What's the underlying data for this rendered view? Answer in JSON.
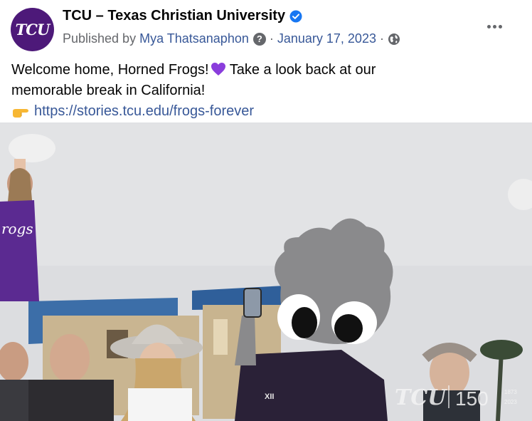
{
  "page": {
    "name": "TCU – Texas Christian University",
    "avatar_text": "TCU",
    "verified_icon": "verified-badge-icon",
    "accent_color": "#4d1979"
  },
  "meta": {
    "published_by_prefix": "Published by",
    "author": "Mya Thatsanaphon",
    "help_glyph": "?",
    "separator": "·",
    "date": "January 17, 2023",
    "audience_icon": "globe-icon"
  },
  "post": {
    "line1": "Welcome home, Horned Frogs!",
    "line1b": " Take a look back at our",
    "line2": "memorable break in California!",
    "link_emoji_icon": "pointing-right-icon",
    "link": "https://stories.tcu.edu/frogs-forever"
  },
  "media": {
    "cheer_text": "rogs",
    "mascot_chest_text": "XII",
    "watermark_logo": "TCU",
    "watermark_150": "150",
    "watermark_year_start": "1873",
    "watermark_year_end": "2023"
  }
}
